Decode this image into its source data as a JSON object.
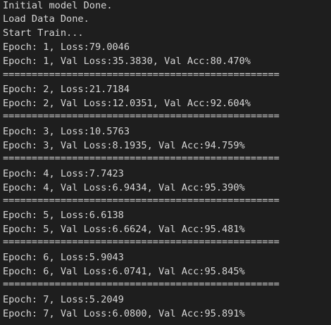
{
  "console": {
    "lines": [
      "Initial model Done.",
      "Load Data Done.",
      "Start Train...",
      "Epoch: 1, Loss:79.0046",
      "Epoch: 1, Val Loss:35.3830, Val Acc:80.470%",
      "================================================",
      "Epoch: 2, Loss:21.7184",
      "Epoch: 2, Val Loss:12.0351, Val Acc:92.604%",
      "================================================",
      "Epoch: 3, Loss:10.5763",
      "Epoch: 3, Val Loss:8.1935, Val Acc:94.759%",
      "================================================",
      "Epoch: 4, Loss:7.7423",
      "Epoch: 4, Val Loss:6.9434, Val Acc:95.390%",
      "================================================",
      "Epoch: 5, Loss:6.6138",
      "Epoch: 5, Val Loss:6.6624, Val Acc:95.481%",
      "================================================",
      "Epoch: 6, Loss:5.9043",
      "Epoch: 6, Val Loss:6.0741, Val Acc:95.845%",
      "================================================",
      "Epoch: 7, Loss:5.2049",
      "Epoch: 7, Val Loss:6.0800, Val Acc:95.891%"
    ],
    "background_color": "#1e1e1e",
    "text_color": "#d6d6d6"
  }
}
